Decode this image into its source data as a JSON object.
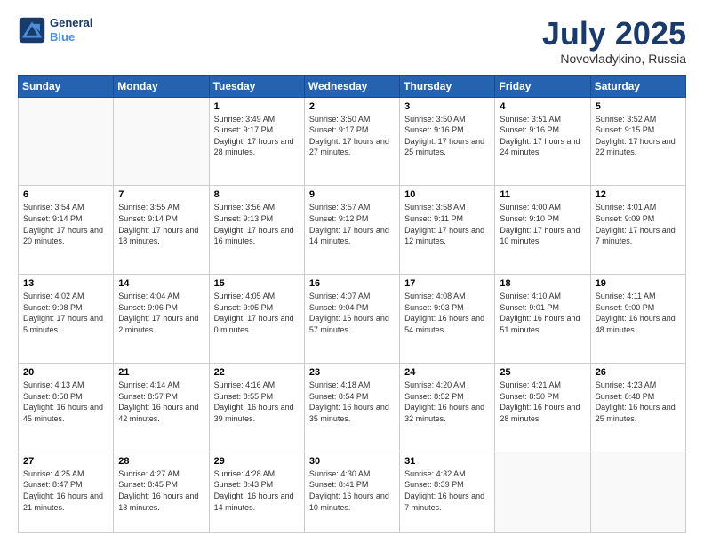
{
  "header": {
    "logo_line1": "General",
    "logo_line2": "Blue",
    "title": "July 2025",
    "location": "Novovladykino, Russia"
  },
  "weekdays": [
    "Sunday",
    "Monday",
    "Tuesday",
    "Wednesday",
    "Thursday",
    "Friday",
    "Saturday"
  ],
  "weeks": [
    [
      {
        "date": "",
        "sunrise": "",
        "sunset": "",
        "daylight": ""
      },
      {
        "date": "",
        "sunrise": "",
        "sunset": "",
        "daylight": ""
      },
      {
        "date": "1",
        "sunrise": "Sunrise: 3:49 AM",
        "sunset": "Sunset: 9:17 PM",
        "daylight": "Daylight: 17 hours and 28 minutes."
      },
      {
        "date": "2",
        "sunrise": "Sunrise: 3:50 AM",
        "sunset": "Sunset: 9:17 PM",
        "daylight": "Daylight: 17 hours and 27 minutes."
      },
      {
        "date": "3",
        "sunrise": "Sunrise: 3:50 AM",
        "sunset": "Sunset: 9:16 PM",
        "daylight": "Daylight: 17 hours and 25 minutes."
      },
      {
        "date": "4",
        "sunrise": "Sunrise: 3:51 AM",
        "sunset": "Sunset: 9:16 PM",
        "daylight": "Daylight: 17 hours and 24 minutes."
      },
      {
        "date": "5",
        "sunrise": "Sunrise: 3:52 AM",
        "sunset": "Sunset: 9:15 PM",
        "daylight": "Daylight: 17 hours and 22 minutes."
      }
    ],
    [
      {
        "date": "6",
        "sunrise": "Sunrise: 3:54 AM",
        "sunset": "Sunset: 9:14 PM",
        "daylight": "Daylight: 17 hours and 20 minutes."
      },
      {
        "date": "7",
        "sunrise": "Sunrise: 3:55 AM",
        "sunset": "Sunset: 9:14 PM",
        "daylight": "Daylight: 17 hours and 18 minutes."
      },
      {
        "date": "8",
        "sunrise": "Sunrise: 3:56 AM",
        "sunset": "Sunset: 9:13 PM",
        "daylight": "Daylight: 17 hours and 16 minutes."
      },
      {
        "date": "9",
        "sunrise": "Sunrise: 3:57 AM",
        "sunset": "Sunset: 9:12 PM",
        "daylight": "Daylight: 17 hours and 14 minutes."
      },
      {
        "date": "10",
        "sunrise": "Sunrise: 3:58 AM",
        "sunset": "Sunset: 9:11 PM",
        "daylight": "Daylight: 17 hours and 12 minutes."
      },
      {
        "date": "11",
        "sunrise": "Sunrise: 4:00 AM",
        "sunset": "Sunset: 9:10 PM",
        "daylight": "Daylight: 17 hours and 10 minutes."
      },
      {
        "date": "12",
        "sunrise": "Sunrise: 4:01 AM",
        "sunset": "Sunset: 9:09 PM",
        "daylight": "Daylight: 17 hours and 7 minutes."
      }
    ],
    [
      {
        "date": "13",
        "sunrise": "Sunrise: 4:02 AM",
        "sunset": "Sunset: 9:08 PM",
        "daylight": "Daylight: 17 hours and 5 minutes."
      },
      {
        "date": "14",
        "sunrise": "Sunrise: 4:04 AM",
        "sunset": "Sunset: 9:06 PM",
        "daylight": "Daylight: 17 hours and 2 minutes."
      },
      {
        "date": "15",
        "sunrise": "Sunrise: 4:05 AM",
        "sunset": "Sunset: 9:05 PM",
        "daylight": "Daylight: 17 hours and 0 minutes."
      },
      {
        "date": "16",
        "sunrise": "Sunrise: 4:07 AM",
        "sunset": "Sunset: 9:04 PM",
        "daylight": "Daylight: 16 hours and 57 minutes."
      },
      {
        "date": "17",
        "sunrise": "Sunrise: 4:08 AM",
        "sunset": "Sunset: 9:03 PM",
        "daylight": "Daylight: 16 hours and 54 minutes."
      },
      {
        "date": "18",
        "sunrise": "Sunrise: 4:10 AM",
        "sunset": "Sunset: 9:01 PM",
        "daylight": "Daylight: 16 hours and 51 minutes."
      },
      {
        "date": "19",
        "sunrise": "Sunrise: 4:11 AM",
        "sunset": "Sunset: 9:00 PM",
        "daylight": "Daylight: 16 hours and 48 minutes."
      }
    ],
    [
      {
        "date": "20",
        "sunrise": "Sunrise: 4:13 AM",
        "sunset": "Sunset: 8:58 PM",
        "daylight": "Daylight: 16 hours and 45 minutes."
      },
      {
        "date": "21",
        "sunrise": "Sunrise: 4:14 AM",
        "sunset": "Sunset: 8:57 PM",
        "daylight": "Daylight: 16 hours and 42 minutes."
      },
      {
        "date": "22",
        "sunrise": "Sunrise: 4:16 AM",
        "sunset": "Sunset: 8:55 PM",
        "daylight": "Daylight: 16 hours and 39 minutes."
      },
      {
        "date": "23",
        "sunrise": "Sunrise: 4:18 AM",
        "sunset": "Sunset: 8:54 PM",
        "daylight": "Daylight: 16 hours and 35 minutes."
      },
      {
        "date": "24",
        "sunrise": "Sunrise: 4:20 AM",
        "sunset": "Sunset: 8:52 PM",
        "daylight": "Daylight: 16 hours and 32 minutes."
      },
      {
        "date": "25",
        "sunrise": "Sunrise: 4:21 AM",
        "sunset": "Sunset: 8:50 PM",
        "daylight": "Daylight: 16 hours and 28 minutes."
      },
      {
        "date": "26",
        "sunrise": "Sunrise: 4:23 AM",
        "sunset": "Sunset: 8:48 PM",
        "daylight": "Daylight: 16 hours and 25 minutes."
      }
    ],
    [
      {
        "date": "27",
        "sunrise": "Sunrise: 4:25 AM",
        "sunset": "Sunset: 8:47 PM",
        "daylight": "Daylight: 16 hours and 21 minutes."
      },
      {
        "date": "28",
        "sunrise": "Sunrise: 4:27 AM",
        "sunset": "Sunset: 8:45 PM",
        "daylight": "Daylight: 16 hours and 18 minutes."
      },
      {
        "date": "29",
        "sunrise": "Sunrise: 4:28 AM",
        "sunset": "Sunset: 8:43 PM",
        "daylight": "Daylight: 16 hours and 14 minutes."
      },
      {
        "date": "30",
        "sunrise": "Sunrise: 4:30 AM",
        "sunset": "Sunset: 8:41 PM",
        "daylight": "Daylight: 16 hours and 10 minutes."
      },
      {
        "date": "31",
        "sunrise": "Sunrise: 4:32 AM",
        "sunset": "Sunset: 8:39 PM",
        "daylight": "Daylight: 16 hours and 7 minutes."
      },
      {
        "date": "",
        "sunrise": "",
        "sunset": "",
        "daylight": ""
      },
      {
        "date": "",
        "sunrise": "",
        "sunset": "",
        "daylight": ""
      }
    ]
  ]
}
